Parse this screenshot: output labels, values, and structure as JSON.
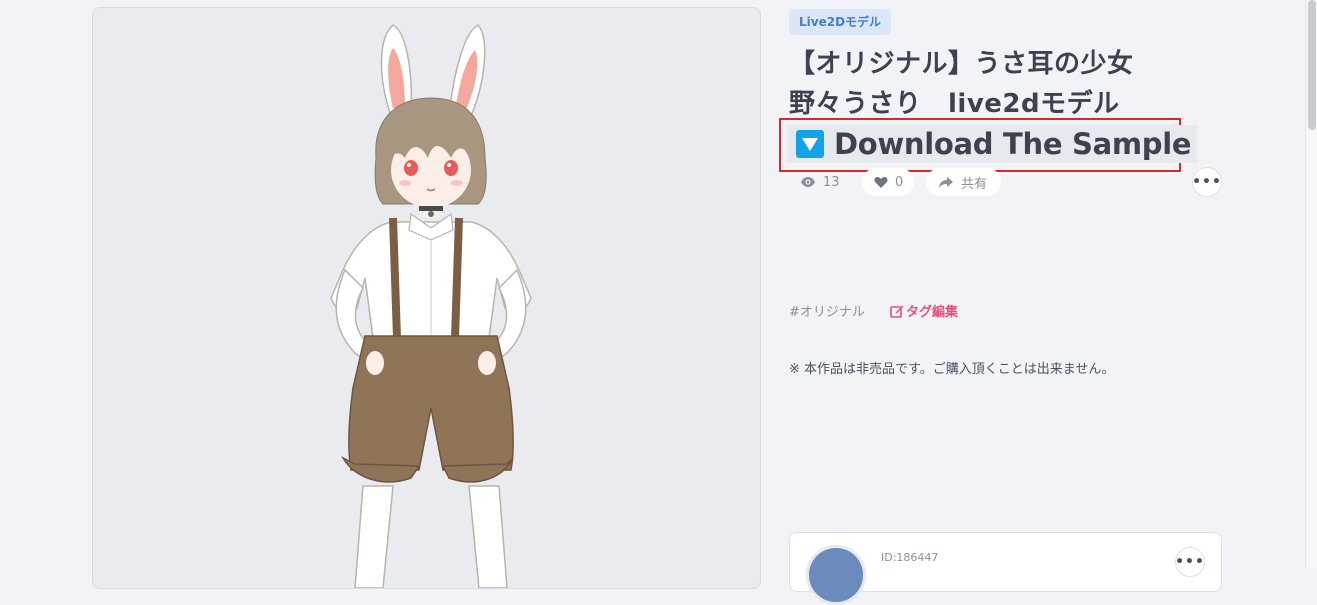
{
  "work": {
    "category": "Live2Dモデル",
    "title_line1": "【オリジナル】うさ耳の少女",
    "title_line2": "野々うさり　live2dモデル",
    "download_label": "Download The Sample",
    "views": "13",
    "likes": "0",
    "share_label": "共有",
    "tags": [
      "#オリジナル"
    ],
    "tag_edit_label": "タグ編集",
    "notice": "※ 本作品は非売品です。ご購入頂くことは出来ません。"
  },
  "author": {
    "id": "ID:186447"
  },
  "icons": {
    "download": "download-triangle-icon",
    "views": "eye-icon",
    "likes": "heart-icon",
    "share": "share-arrow-icon",
    "tag_edit": "edit-icon",
    "more": "more-dots-icon"
  },
  "colors": {
    "accent_blue": "#12a3e8",
    "badge_text": "#3f7fcf",
    "tag_edit": "#e8507a",
    "highlight_box": "#d42a2a"
  }
}
